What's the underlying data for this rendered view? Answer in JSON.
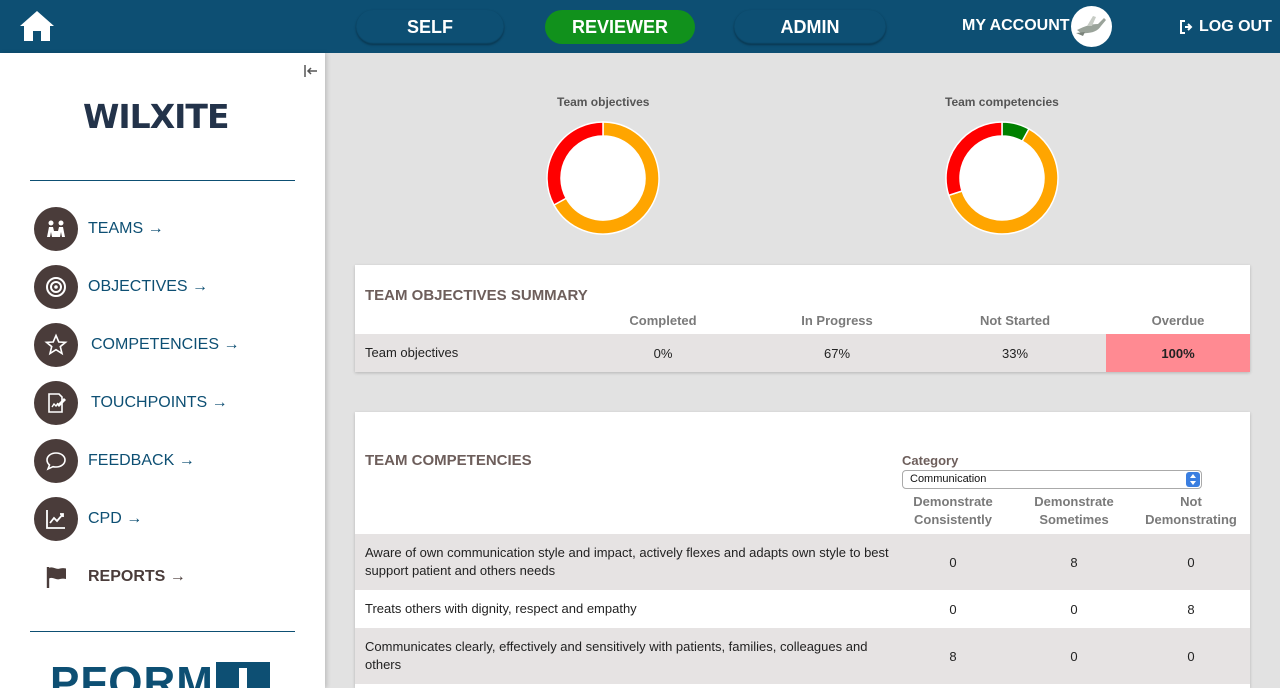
{
  "topbar": {
    "tabs": [
      {
        "label": "SELF"
      },
      {
        "label": "REVIEWER"
      },
      {
        "label": "ADMIN"
      }
    ],
    "account_label": "MY ACCOUNT",
    "logout_label": "LOG OUT"
  },
  "sidebar": {
    "logo_text": "WILXITE",
    "items": [
      {
        "label": "TEAMS →",
        "icon": "teams-icon"
      },
      {
        "label": "OBJECTIVES →",
        "icon": "target-icon"
      },
      {
        "label": "COMPETENCIES →",
        "icon": "star-icon"
      },
      {
        "label": "TOUCHPOINTS →",
        "icon": "document-edit-icon"
      },
      {
        "label": "FEEDBACK →",
        "icon": "speech-bubble-icon"
      },
      {
        "label": "CPD →",
        "icon": "trend-chart-icon"
      },
      {
        "label": "REPORTS →",
        "icon": "flag-icon"
      }
    ],
    "bottom_logo_text": "PFORM"
  },
  "charts": {
    "objectives_title": "Team objectives",
    "competencies_title": "Team competencies",
    "colors": {
      "red": "#ff0000",
      "orange": "#ffa500",
      "green": "#008000"
    }
  },
  "chart_data": [
    {
      "type": "pie",
      "title": "Team objectives",
      "values": [
        67,
        33
      ],
      "colors": [
        "#ffa500",
        "#ff0000"
      ]
    },
    {
      "type": "pie",
      "title": "Team competencies",
      "values": [
        8,
        62,
        30
      ],
      "colors": [
        "#008000",
        "#ffa500",
        "#ff0000"
      ]
    }
  ],
  "objectives_summary": {
    "title": "TEAM OBJECTIVES SUMMARY",
    "headers": [
      "Completed",
      "In Progress",
      "Not Started",
      "Overdue"
    ],
    "rows": [
      {
        "name": "Team objectives",
        "completed": "0%",
        "in_progress": "67%",
        "not_started": "33%",
        "overdue": "100%"
      }
    ]
  },
  "competencies": {
    "title": "TEAM COMPETENCIES",
    "category_label": "Category",
    "category_value": "Communication",
    "headers": [
      "Demonstrate Consistently",
      "Demonstrate Sometimes",
      "Not Demonstrating"
    ],
    "rows": [
      {
        "text": "Aware of own communication style and impact, actively flexes and adapts own style to best support patient and others needs",
        "consistently": "0",
        "sometimes": "8",
        "not": "0"
      },
      {
        "text": "Treats others with dignity, respect and empathy",
        "consistently": "0",
        "sometimes": "0",
        "not": "8"
      },
      {
        "text": "Communicates clearly, effectively and sensitively with patients, families, colleagues and others",
        "consistently": "8",
        "sometimes": "0",
        "not": "0"
      }
    ]
  }
}
